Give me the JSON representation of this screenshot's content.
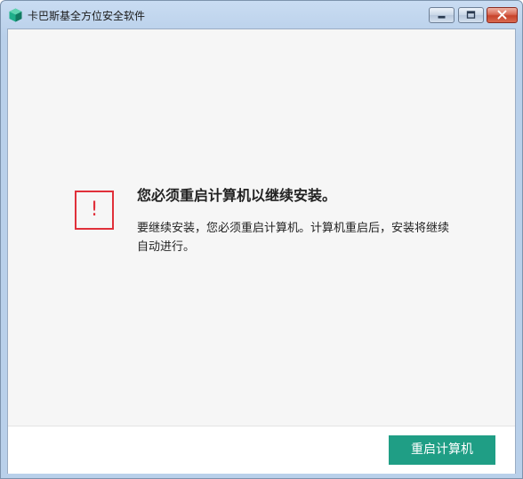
{
  "window": {
    "title": "卡巴斯基全方位安全软件",
    "controls": {
      "minimize_icon": "minimize-icon",
      "maximize_icon": "maximize-icon",
      "close_icon": "close-icon"
    }
  },
  "message": {
    "icon": "warning-exclamation-icon",
    "icon_glyph": "!",
    "heading": "您必须重启计算机以继续安装。",
    "body": "要继续安装，您必须重启计算机。计算机重启后，安装将继续自动进行。"
  },
  "footer": {
    "restart_button_label": "重启计算机"
  },
  "colors": {
    "accent": "#1f9e85",
    "warning": "#e0303a",
    "background": "#f6f6f6"
  }
}
